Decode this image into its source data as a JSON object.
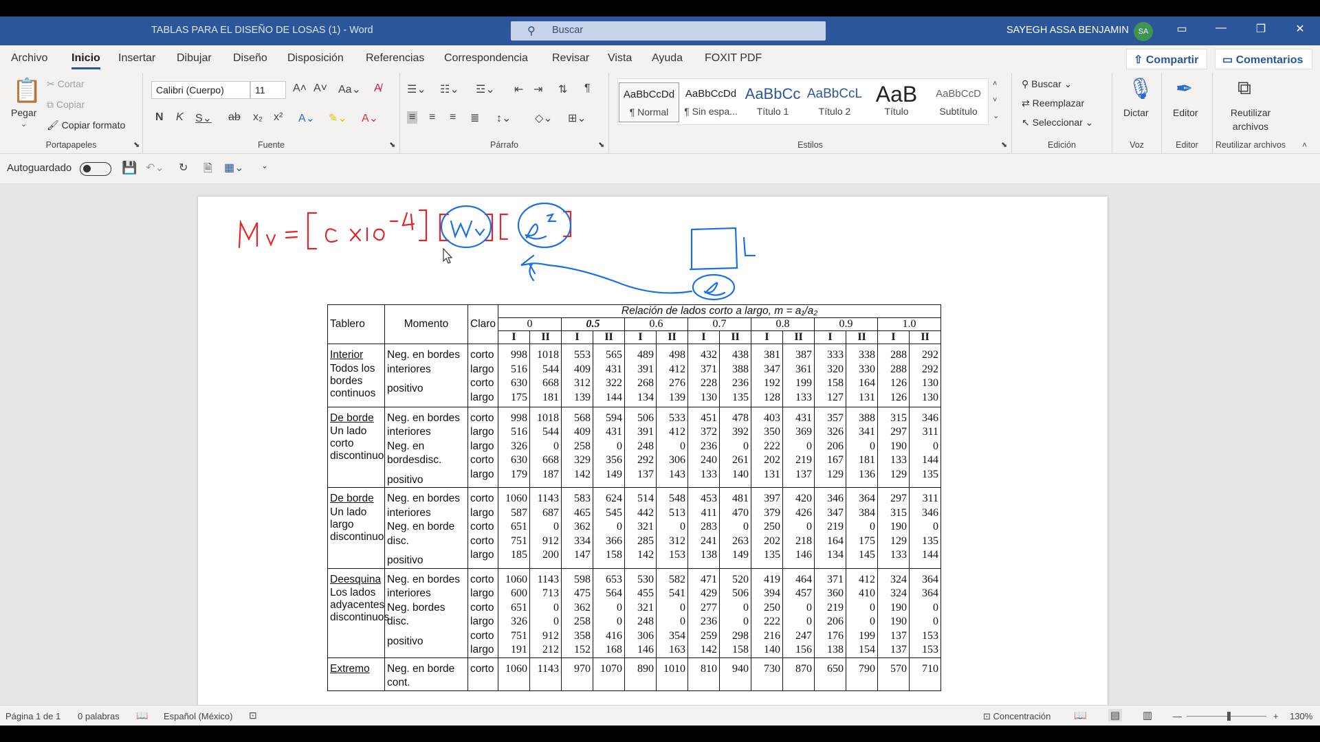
{
  "window": {
    "title": "TABLAS PARA EL DISEÑO DE LOSAS (1)  -  Word",
    "search_placeholder": "Buscar",
    "user": "SAYEGH ASSA BENJAMIN",
    "avatar": "SA"
  },
  "menu": {
    "tabs": [
      "Archivo",
      "Inicio",
      "Insertar",
      "Dibujar",
      "Diseño",
      "Disposición",
      "Referencias",
      "Correspondencia",
      "Revisar",
      "Vista",
      "Ayuda",
      "FOXIT PDF"
    ],
    "share": "Compartir",
    "comments": "Comentarios"
  },
  "ribbon": {
    "clipboard": {
      "paste": "Pegar",
      "cut": "Cortar",
      "copy": "Copiar",
      "format_painter": "Copiar formato",
      "label": "Portapapeles"
    },
    "font": {
      "name": "Calibri (Cuerpo)",
      "size": "11",
      "label": "Fuente"
    },
    "paragraph": {
      "label": "Párrafo"
    },
    "styles": {
      "label": "Estilos",
      "items": [
        {
          "preview": "AaBbCcDd",
          "name": "¶ Normal"
        },
        {
          "preview": "AaBbCcDd",
          "name": "¶ Sin espa..."
        },
        {
          "preview": "AaBbCc",
          "name": "Título 1"
        },
        {
          "preview": "AaBbCcL",
          "name": "Título 2"
        },
        {
          "preview": "AaB",
          "name": "Título"
        },
        {
          "preview": "AaBbCcD",
          "name": "Subtítulo"
        }
      ]
    },
    "editing": {
      "find": "Buscar",
      "replace": "Reemplazar",
      "select": "Seleccionar",
      "label": "Edición"
    },
    "voice": {
      "dictate": "Dictar",
      "label": "Voz"
    },
    "editor": {
      "editor": "Editor",
      "label": "Editor"
    },
    "reuse": {
      "reuse": "Reutilizar archivos",
      "label": "Reutilizar archivos"
    }
  },
  "qat": {
    "autosave": "Autoguardado"
  },
  "document": {
    "table": {
      "title": "Relación de lados corto a largo, m = a₁/a₂",
      "headers": {
        "tablero": "Tablero",
        "momento": "Momento",
        "claro": "Claro"
      },
      "ratios": [
        "0",
        "0.5",
        "0.6",
        "0.7",
        "0.8",
        "0.9",
        "1.0"
      ],
      "cases": [
        "I",
        "II"
      ],
      "groups": [
        {
          "name": "Interior",
          "desc": "Todos los bordes continuos",
          "moments": [
            "Neg. en bordes interiores",
            "positivo"
          ],
          "claros": [
            "corto",
            "largo",
            "corto",
            "largo"
          ],
          "rows": [
            [
              "998",
              "1018",
              "553",
              "565",
              "489",
              "498",
              "432",
              "438",
              "381",
              "387",
              "333",
              "338",
              "288",
              "292"
            ],
            [
              "516",
              "544",
              "409",
              "431",
              "391",
              "412",
              "371",
              "388",
              "347",
              "361",
              "320",
              "330",
              "288",
              "292"
            ],
            [
              "630",
              "668",
              "312",
              "322",
              "268",
              "276",
              "228",
              "236",
              "192",
              "199",
              "158",
              "164",
              "126",
              "130"
            ],
            [
              "175",
              "181",
              "139",
              "144",
              "134",
              "139",
              "130",
              "135",
              "128",
              "133",
              "127",
              "131",
              "126",
              "130"
            ]
          ]
        },
        {
          "name": "De borde",
          "desc": "Un lado corto discontinuo",
          "moments": [
            "Neg. en bordes interiores",
            "Neg. en bordesdisc.",
            "positivo"
          ],
          "claros": [
            "corto",
            "largo",
            "largo",
            "corto",
            "largo"
          ],
          "rows": [
            [
              "998",
              "1018",
              "568",
              "594",
              "506",
              "533",
              "451",
              "478",
              "403",
              "431",
              "357",
              "388",
              "315",
              "346"
            ],
            [
              "516",
              "544",
              "409",
              "431",
              "391",
              "412",
              "372",
              "392",
              "350",
              "369",
              "326",
              "341",
              "297",
              "311"
            ],
            [
              "326",
              "0",
              "258",
              "0",
              "248",
              "0",
              "236",
              "0",
              "222",
              "0",
              "206",
              "0",
              "190",
              "0"
            ],
            [
              "630",
              "668",
              "329",
              "356",
              "292",
              "306",
              "240",
              "261",
              "202",
              "219",
              "167",
              "181",
              "133",
              "144"
            ],
            [
              "179",
              "187",
              "142",
              "149",
              "137",
              "143",
              "133",
              "140",
              "131",
              "137",
              "129",
              "136",
              "129",
              "135"
            ]
          ]
        },
        {
          "name": "De borde",
          "desc": "Un lado largo discontinuo",
          "moments": [
            "Neg. en bordes interiores",
            "Neg. en borde disc.",
            "positivo"
          ],
          "claros": [
            "corto",
            "largo",
            "corto",
            "corto",
            "largo"
          ],
          "rows": [
            [
              "1060",
              "1143",
              "583",
              "624",
              "514",
              "548",
              "453",
              "481",
              "397",
              "420",
              "346",
              "364",
              "297",
              "311"
            ],
            [
              "587",
              "687",
              "465",
              "545",
              "442",
              "513",
              "411",
              "470",
              "379",
              "426",
              "347",
              "384",
              "315",
              "346"
            ],
            [
              "651",
              "0",
              "362",
              "0",
              "321",
              "0",
              "283",
              "0",
              "250",
              "0",
              "219",
              "0",
              "190",
              "0"
            ],
            [
              "751",
              "912",
              "334",
              "366",
              "285",
              "312",
              "241",
              "263",
              "202",
              "218",
              "164",
              "175",
              "129",
              "135"
            ],
            [
              "185",
              "200",
              "147",
              "158",
              "142",
              "153",
              "138",
              "149",
              "135",
              "146",
              "134",
              "145",
              "133",
              "144"
            ]
          ]
        },
        {
          "name": "Deesquina",
          "desc": "Los lados adyacentes discontinuos",
          "moments": [
            "Neg. en bordes interiores",
            "Neg. bordes disc.",
            "positivo"
          ],
          "claros": [
            "corto",
            "largo",
            "corto",
            "largo",
            "corto",
            "largo"
          ],
          "rows": [
            [
              "1060",
              "1143",
              "598",
              "653",
              "530",
              "582",
              "471",
              "520",
              "419",
              "464",
              "371",
              "412",
              "324",
              "364"
            ],
            [
              "600",
              "713",
              "475",
              "564",
              "455",
              "541",
              "429",
              "506",
              "394",
              "457",
              "360",
              "410",
              "324",
              "364"
            ],
            [
              "651",
              "0",
              "362",
              "0",
              "321",
              "0",
              "277",
              "0",
              "250",
              "0",
              "219",
              "0",
              "190",
              "0"
            ],
            [
              "326",
              "0",
              "258",
              "0",
              "248",
              "0",
              "236",
              "0",
              "222",
              "0",
              "206",
              "0",
              "190",
              "0"
            ],
            [
              "751",
              "912",
              "358",
              "416",
              "306",
              "354",
              "259",
              "298",
              "216",
              "247",
              "176",
              "199",
              "137",
              "153"
            ],
            [
              "191",
              "212",
              "152",
              "168",
              "146",
              "163",
              "142",
              "158",
              "140",
              "156",
              "138",
              "154",
              "137",
              "153"
            ]
          ]
        },
        {
          "name": "Extremo",
          "desc": "",
          "moments": [
            "Neg. en borde cont."
          ],
          "claros": [
            "corto"
          ],
          "rows": [
            [
              "1060",
              "1143",
              "970",
              "1070",
              "890",
              "1010",
              "810",
              "940",
              "730",
              "870",
              "650",
              "790",
              "570",
              "710"
            ]
          ]
        }
      ]
    }
  },
  "status": {
    "page": "Página 1 de 1",
    "words": "0 palabras",
    "language": "Español (México)",
    "focus": "Concentración",
    "zoom": "130%"
  },
  "colors": {
    "title_bar": "#2b579a",
    "ink_red": "#e0262b",
    "ink_blue": "#1a6fe6"
  }
}
